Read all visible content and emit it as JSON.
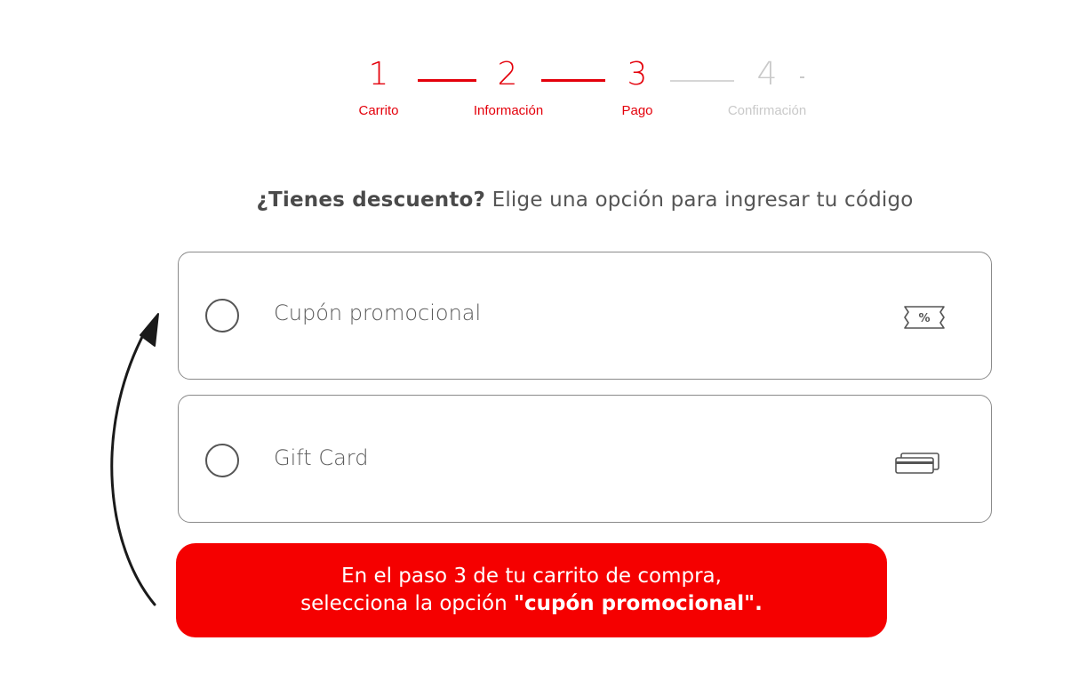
{
  "stepper": {
    "steps": [
      {
        "number": "1",
        "label": "Carrito",
        "state": "done"
      },
      {
        "number": "2",
        "label": "Información",
        "state": "done"
      },
      {
        "number": "3",
        "label": "Pago",
        "state": "current"
      },
      {
        "number": "4",
        "label": "Confirmación",
        "state": "pending"
      }
    ]
  },
  "discount": {
    "heading_bold": "¿Tienes descuento?",
    "heading_rest": " Elige una opción para ingresar tu código",
    "options": [
      {
        "label": "Cupón promocional",
        "icon": "coupon-percent-icon",
        "selected": false
      },
      {
        "label": "Gift Card",
        "icon": "cards-icon",
        "selected": false
      }
    ]
  },
  "callout": {
    "line1": "En el paso 3 de tu carrito de compra,",
    "line2_prefix": "selecciona la opción ",
    "line2_bold": "\"cupón promocional\"."
  },
  "colors": {
    "accent": "#e4000b",
    "callout_bg": "#f50000",
    "inactive": "#c9c9c9",
    "card_border": "#8a8a8a"
  }
}
